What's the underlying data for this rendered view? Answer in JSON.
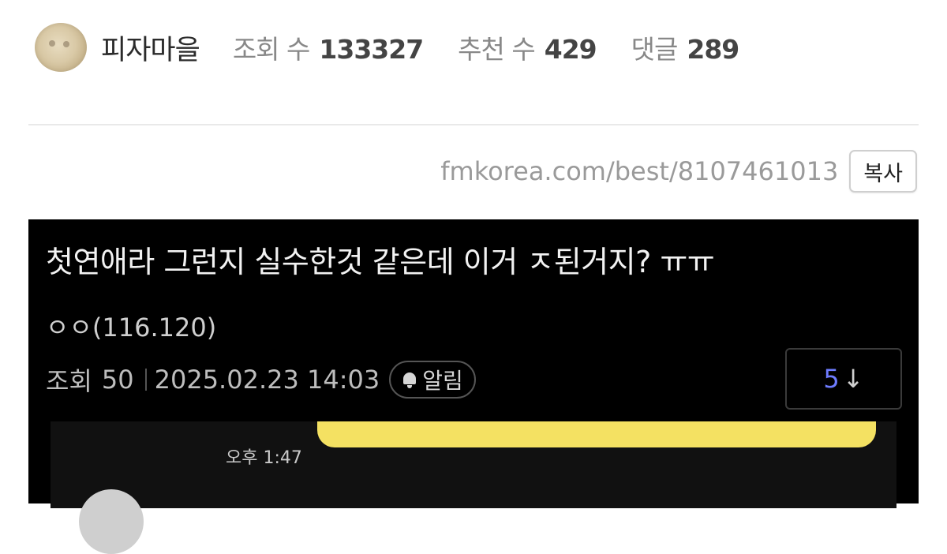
{
  "header": {
    "nickname": "피자마을",
    "stats": [
      {
        "label": "조회 수",
        "value": "133327"
      },
      {
        "label": "추천 수",
        "value": "429"
      },
      {
        "label": "댓글",
        "value": "289"
      }
    ]
  },
  "link": {
    "url": "fmkorea.com/best/8107461013",
    "copy_label": "복사"
  },
  "embedded_post": {
    "title": "첫연애라 그런지 실수한것 같은데 이거 ㅈ된거지? ㅠㅠ",
    "author": "ㅇㅇ(116.120)",
    "views_label": "조회",
    "views": "50",
    "datetime": "2025.02.23 14:03",
    "alarm_label": "알림",
    "comment_jump_count": "5",
    "comment_jump_arrow": "↓"
  },
  "chat_preview": {
    "time": "오후 1:47"
  },
  "colors": {
    "background": "#ffffff",
    "dark_panel": "#000000",
    "chat_bubble": "#f4e162",
    "jump_count": "#6e7cff"
  }
}
